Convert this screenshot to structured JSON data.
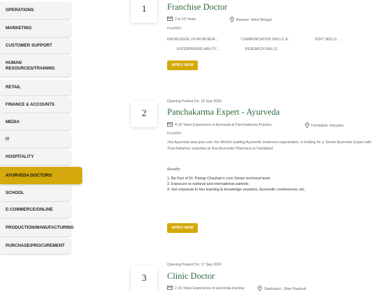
{
  "sidebar": {
    "items": [
      {
        "label": "OPERATIONS"
      },
      {
        "label": "MARKETING"
      },
      {
        "label": "CUSTOMER SUPPORT"
      },
      {
        "label": "HUMAN RESOURCES/TRAINING"
      },
      {
        "label": "RETAIL"
      },
      {
        "label": "FINANCE & ACCOUNTS"
      },
      {
        "label": "MEDIA"
      },
      {
        "label": "IT"
      },
      {
        "label": "HOSPITALITY"
      },
      {
        "label": "AYURVEDA DOCTORS",
        "active": true
      },
      {
        "label": "SCHOOL"
      },
      {
        "label": "E-COMMERCE/ONLINE"
      },
      {
        "label": "PRODUCTION/MANUFACTURING"
      },
      {
        "label": "PURCHASE/PROCUREMENT"
      }
    ]
  },
  "accent_color": "#d4a90b",
  "title_color": "#2e6b3d",
  "jobs": [
    {
      "number": "1",
      "title": "Franchise Doctor",
      "experience": "2 to 10 Years",
      "location": "Asansol -West Bengal",
      "keyskills_label": "Keyskills",
      "skills": [
        "KNOWLEDGE OF AYURVEDA ...",
        "COMMUNICATION SKILLS, A...",
        "SOFT SKILLS ...",
        "ENTERPRISING ABILITY, ...",
        "RESEARCH SKILLS"
      ],
      "apply_label": "APPLY NOW"
    },
    {
      "number": "2",
      "posted": "Opening Posted On: 15 Sep 2024",
      "title": "Panchakarma Expert - Ayurveda",
      "experience": "4-15 Years Experience in Ayurveda & Panchakarma Practice",
      "location": "Faridabad -Haryana",
      "keyskills_label": "Keyskills",
      "description": "Jiva Ayurveda www.jiva.com, the World's leading Ayurvedic treatment organisation, is looking for a 'Senior Ayurvedic Expert with 'Panchakarma' expertise at Jiva Ayurvedic Pharmacy in Faridabad.",
      "benefits_title": "Benefits",
      "benefits": [
        "1. Be Part of Dr. Partap Chauhan's core Senior technical team",
        "2. Exposure to national and international patients",
        "3. Get exposure to two learning & knowledge sessions, Ayurvedic conferences, etc."
      ],
      "apply_label": "APPLY NOW"
    },
    {
      "number": "3",
      "posted": "Opening Posted On: 17 Sep 2024",
      "title": "Clinic Doctor",
      "experience": "2-15 Years Experience in ayurveda practise",
      "location": "Jharkhand , Uttar Pradesh"
    }
  ],
  "icons": {
    "experience": "mail-icon",
    "location": "map-pin-icon"
  }
}
